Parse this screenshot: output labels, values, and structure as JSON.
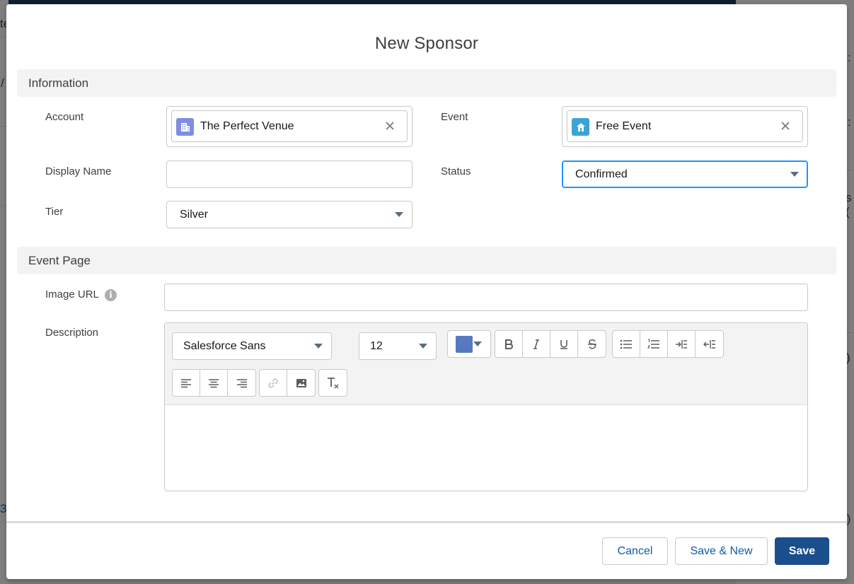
{
  "background": {
    "fragments": [
      "te",
      "/",
      ":",
      ":",
      "s (",
      ")",
      "3",
      ".)"
    ]
  },
  "modal": {
    "title": "New Sponsor",
    "sections": {
      "information": "Information",
      "event_page": "Event Page"
    },
    "fields": {
      "account": {
        "label": "Account",
        "value": "The Perfect Venue",
        "icon": "account-building-icon",
        "icon_color": "#7f8de1"
      },
      "event": {
        "label": "Event",
        "value": "Free Event",
        "icon": "event-icon",
        "icon_color": "#3ba4d6"
      },
      "display_name": {
        "label": "Display Name",
        "value": ""
      },
      "status": {
        "label": "Status",
        "value": "Confirmed"
      },
      "tier": {
        "label": "Tier",
        "value": "Silver"
      },
      "image_url": {
        "label": "Image URL",
        "value": "",
        "info_icon": "i"
      },
      "description": {
        "label": "Description",
        "value": ""
      }
    },
    "editor": {
      "font_family": "Salesforce Sans",
      "font_size": "12",
      "text_color": "#5679c0",
      "buttons": [
        "bold-icon",
        "italic-icon",
        "underline-icon",
        "strikethrough-icon",
        "bulleted-list-icon",
        "numbered-list-icon",
        "indent-icon",
        "outdent-icon",
        "align-left-icon",
        "align-center-icon",
        "align-right-icon",
        "link-icon",
        "image-icon",
        "clear-formatting-icon"
      ]
    },
    "footer": {
      "cancel": "Cancel",
      "save_new": "Save & New",
      "save": "Save"
    }
  },
  "colors": {
    "brand": "#1b4e8c",
    "link": "#0b5cab",
    "focus": "#1b96ff"
  }
}
